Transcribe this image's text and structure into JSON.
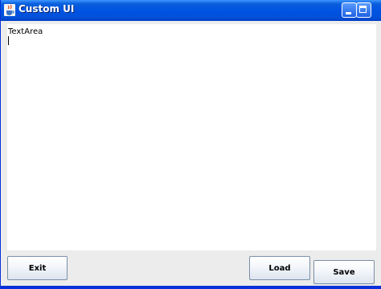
{
  "window": {
    "title": "Custom UI",
    "icon": "java-cup-icon"
  },
  "textarea": {
    "value": "TextArea"
  },
  "buttons": {
    "exit_label": "Exit",
    "load_label": "Load",
    "save_label": "Save"
  },
  "colors": {
    "titlebar": "#0054e3",
    "frame": "#0831d9",
    "panel": "#ececec"
  }
}
